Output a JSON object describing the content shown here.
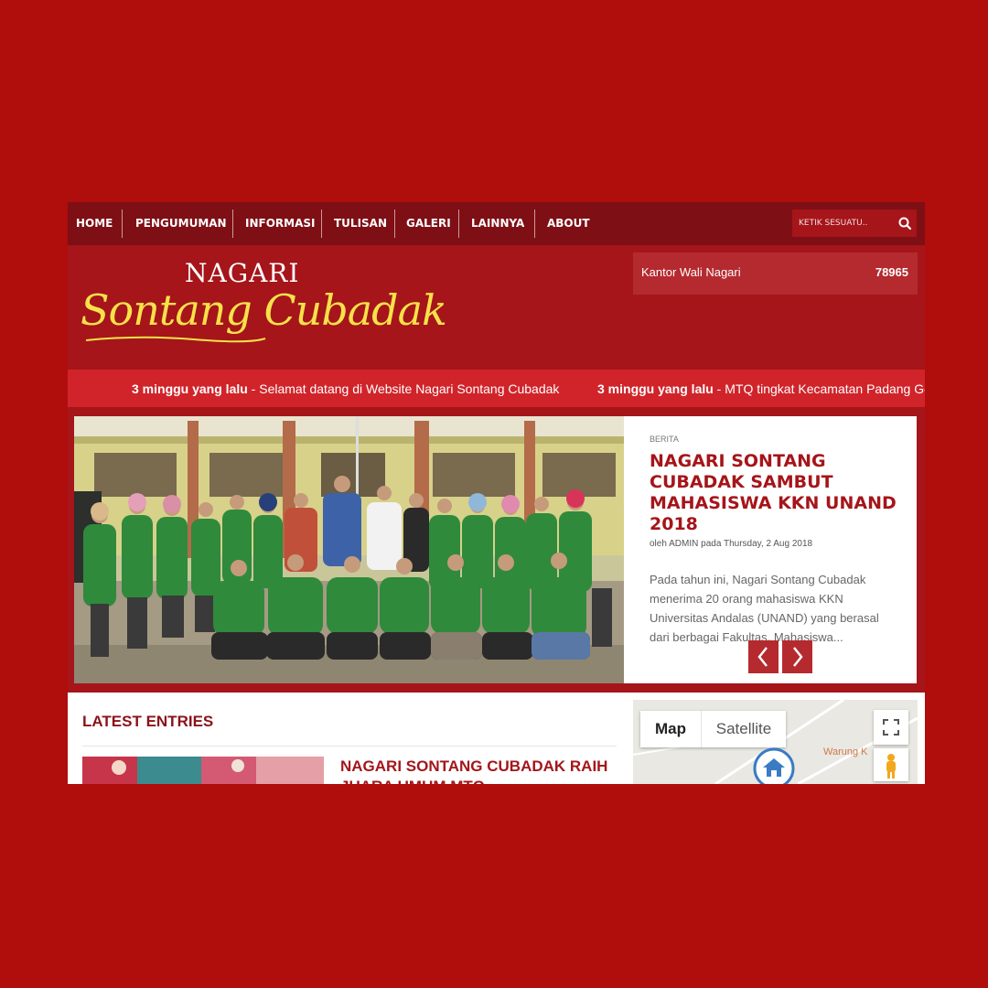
{
  "nav": {
    "items": [
      {
        "label": "HOME"
      },
      {
        "label": "PENGUMUMAN"
      },
      {
        "label": "INFORMASI"
      },
      {
        "label": "TULISAN"
      },
      {
        "label": "GALERI"
      },
      {
        "label": "LAINNYA"
      },
      {
        "label": "ABOUT"
      }
    ],
    "search_placeholder": "KETIK SESUATU..",
    "search_icon": "search-icon"
  },
  "header": {
    "logo_top": "NAGARI",
    "logo_script": "Sontang Cubadak",
    "counter_label": "Kantor Wali Nagari",
    "counter_value": "78965"
  },
  "ticker": {
    "items": [
      {
        "time": "3 minggu yang lalu",
        "text": " - Selamat datang di Website Nagari Sontang Cubadak"
      },
      {
        "time": "3 minggu yang lalu",
        "text": " - MTQ tingkat Kecamatan Padang Ge"
      }
    ]
  },
  "slider": {
    "category": "BERITA",
    "title": "NAGARI SONTANG CUBADAK SAMBUT MAHASISWA KKN UNAND 2018",
    "meta": "oleh ADMIN pada Thursday, 2 Aug 2018",
    "excerpt": "Pada tahun ini,  Nagari Sontang Cubadak menerima 20 orang mahasiswa KKN Universitas Andalas (UNAND) yang berasal dari berbagai Fakultas. Mahasiswa...",
    "prev_icon": "chevron-left-icon",
    "next_icon": "chevron-right-icon"
  },
  "latest": {
    "heading": "LATEST ENTRIES",
    "entry_title": "NAGARI SONTANG CUBADAK RAIH JUARA UMUM MTQ"
  },
  "map": {
    "tab_map": "Map",
    "tab_satellite": "Satellite",
    "place_label": "Warung K",
    "fullscreen_icon": "fullscreen-icon",
    "pegman_icon": "pegman-icon",
    "marker_icon": "home-marker-icon"
  },
  "colors": {
    "background": "#b00d0d",
    "nav": "#7e0f15",
    "header": "#a5151a",
    "ticker": "#d0242a",
    "accent": "#a5151a",
    "logo_yellow": "#f7e14a"
  }
}
